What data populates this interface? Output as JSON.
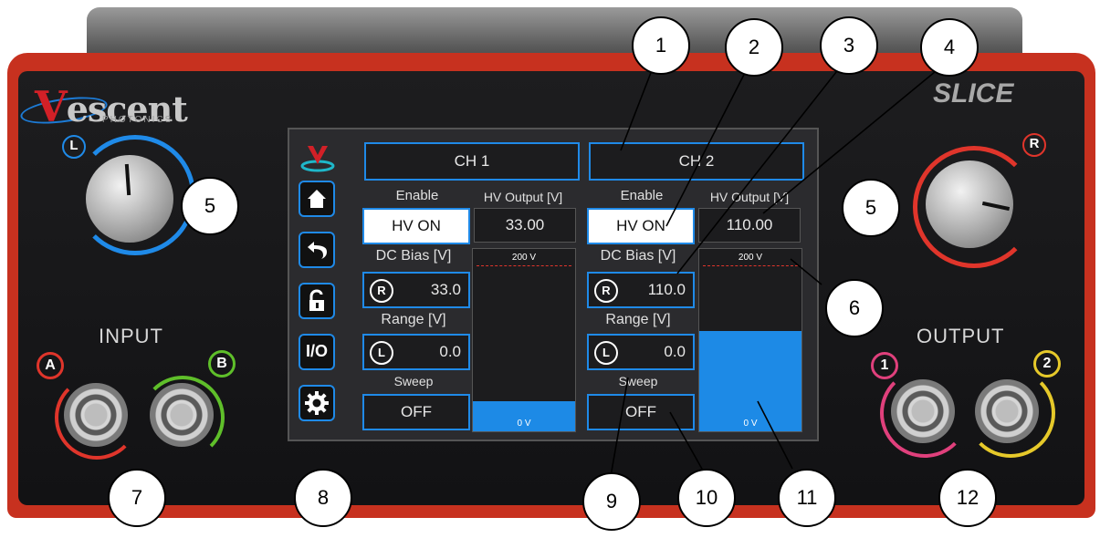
{
  "device": {
    "brand": "escent",
    "brand_initial": "V",
    "brand_sub": "PHOTONICS",
    "model": "SLICE"
  },
  "knobs": {
    "left_letter": "L",
    "right_letter": "R"
  },
  "ports": {
    "input_label": "INPUT",
    "input_a": "A",
    "input_b": "B",
    "output_label": "OUTPUT",
    "output_1": "1",
    "output_2": "2"
  },
  "sidebar": {
    "io_label": "I/O"
  },
  "channels": [
    {
      "title": "CH 1",
      "enable_label": "Enable",
      "hv_output_label": "HV Output [V]",
      "enable_value": "HV ON",
      "hv_output_value": "33.00",
      "dc_bias_label": "DC Bias [V]",
      "dc_bias_badge": "R",
      "dc_bias_value": "33.0",
      "range_label": "Range [V]",
      "range_badge": "L",
      "range_value": "0.0",
      "sweep_label": "Sweep",
      "sweep_value": "OFF",
      "bar_top": "200 V",
      "bar_bottom": "0 V",
      "bar_level": 0.165
    },
    {
      "title": "CH 2",
      "enable_label": "Enable",
      "hv_output_label": "HV Output [V]",
      "enable_value": "HV ON",
      "hv_output_value": "110.00",
      "dc_bias_label": "DC Bias [V]",
      "dc_bias_badge": "R",
      "dc_bias_value": "110.0",
      "range_label": "Range [V]",
      "range_badge": "L",
      "range_value": "0.0",
      "sweep_label": "Sweep",
      "sweep_value": "OFF",
      "bar_top": "200 V",
      "bar_bottom": "0 V",
      "bar_level": 0.55
    }
  ],
  "callouts": {
    "c1": "1",
    "c2": "2",
    "c3": "3",
    "c4": "4",
    "c5a": "5",
    "c5b": "5",
    "c6": "6",
    "c7": "7",
    "c8": "8",
    "c9": "9",
    "c10": "10",
    "c11": "11",
    "c12": "12"
  },
  "colors": {
    "chassis_red": "#c7311f",
    "accent_blue": "#1f8ae8",
    "port_a": "#e0352b",
    "port_b": "#5fbf2a",
    "port_1": "#e0407c",
    "port_2": "#e6c92a"
  }
}
